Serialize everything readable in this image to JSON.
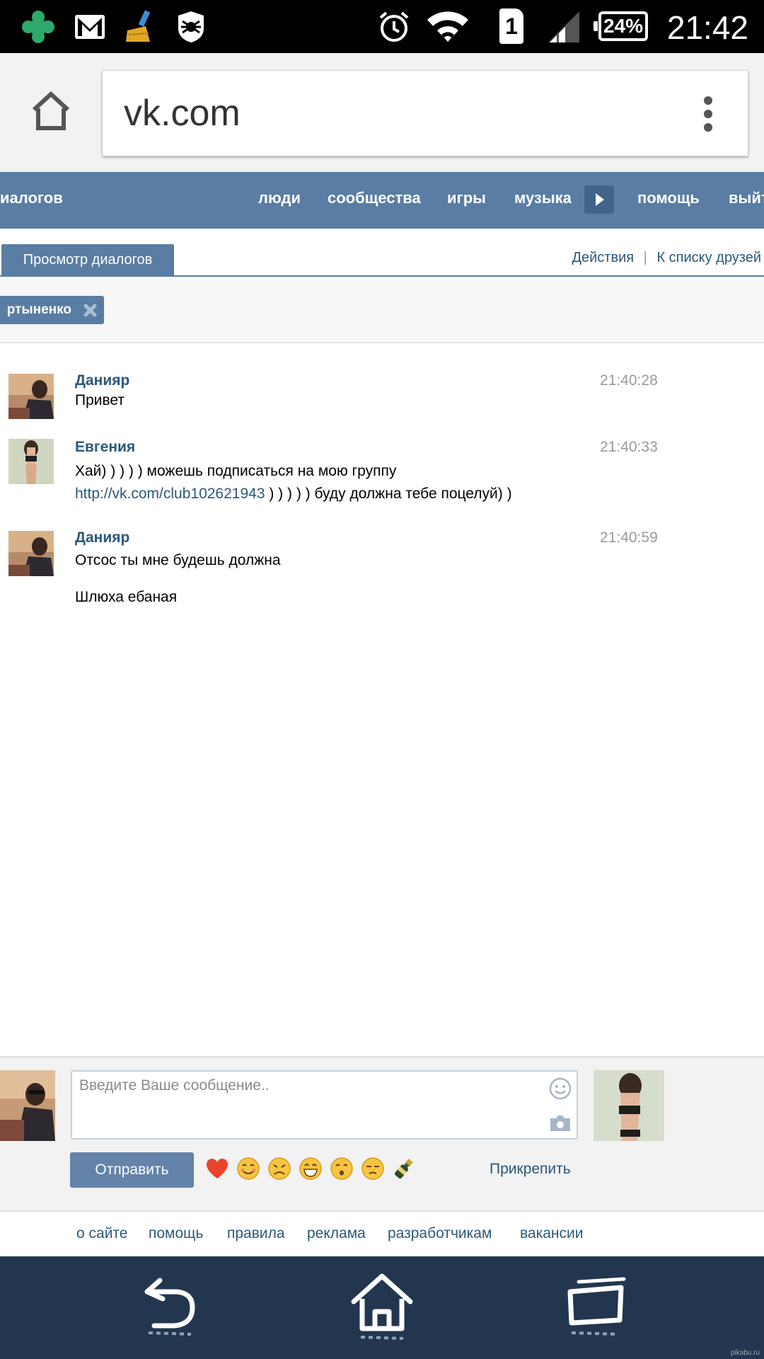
{
  "status_bar": {
    "clock": "21:42",
    "battery": "24%",
    "sim_slot": "1",
    "icons": [
      "plus-app-icon",
      "gmail-icon",
      "clean-master-broom-icon",
      "dr-web-spider-icon",
      "alarm-icon",
      "wifi-icon",
      "sim-card-icon",
      "signal-icon",
      "battery-icon"
    ]
  },
  "browser": {
    "url": "vk.com",
    "home_icon": "home-icon",
    "menu_icon": "overflow-menu-icon"
  },
  "vk_nav": {
    "items": [
      {
        "label": "иалогов"
      },
      {
        "label": "люди"
      },
      {
        "label": "сообщества"
      },
      {
        "label": "игры"
      },
      {
        "label": "музыка"
      },
      {
        "label": "помощь"
      },
      {
        "label": "выйт"
      }
    ],
    "accent": "#597da3"
  },
  "tabs": {
    "active": "Просмотр диалогов",
    "action1": "Действия",
    "separator": "|",
    "action2": "К списку друзей"
  },
  "chip": {
    "label": "ртыненко"
  },
  "messages": [
    {
      "author": "Данияр",
      "time": "21:40:28",
      "lines": [
        "Привет"
      ]
    },
    {
      "author": "Евгения",
      "time": "21:40:33",
      "line1": "Хай) ) ) ) ) можешь подписаться на мою группу",
      "link": "http://vk.com/club102621943",
      "line2_rest": " ) ) ) ) ) буду должна тебе поцелуй) )"
    },
    {
      "author": "Данияр",
      "time": "21:40:59",
      "lines": [
        "Отсос ты мне будешь должна",
        "Шлюха ебаная"
      ]
    }
  ],
  "composer": {
    "placeholder": "Введите Ваше сообщение..",
    "send_label": "Отправить",
    "attach_label": "Прикрепить",
    "emojis": [
      "heart",
      "smile",
      "disappointed",
      "grin",
      "kiss",
      "relieved",
      "champagne"
    ]
  },
  "footer_links": [
    "о сайте",
    "помощь",
    "правила",
    "реклама",
    "разработчикам",
    "вакансии"
  ],
  "android_nav": {
    "buttons": [
      "back-icon",
      "home-icon",
      "recents-icon"
    ]
  },
  "watermark": "pikabu.ru"
}
